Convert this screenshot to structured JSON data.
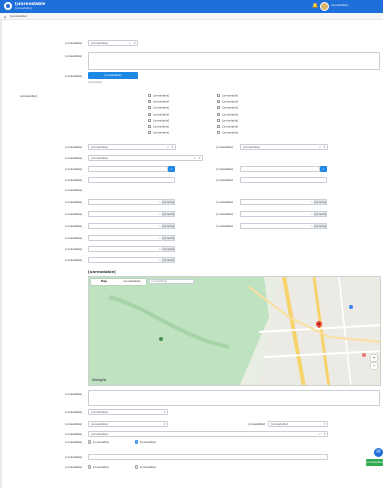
{
  "header": {
    "app_name": "[unreadable]",
    "app_subtitle": "[unreadable]",
    "bell_icon": "bell-icon",
    "user_name": "[unreadable]"
  },
  "breadcrumb": {
    "text": "[unreadable]"
  },
  "form": {
    "prefix_label": "[unreadable]",
    "prefix_value": "[unreadable]",
    "name_label": "[unreadable]",
    "doc_label": "[unreadable]",
    "upload_button": "[unreadable]",
    "upload_hint": "[unreadable]",
    "facilities_label": "[unreadable]",
    "facilities_col1": [
      "[unreadable]",
      "[unreadable]",
      "[unreadable]",
      "[unreadable]",
      "[unreadable]",
      "[unreadable]",
      "[unreadable]"
    ],
    "facilities_col2": [
      "[unreadable]",
      "[unreadable]",
      "[unreadable]",
      "[unreadable]",
      "[unreadable]",
      "[unreadable]",
      "[unreadable]"
    ],
    "type_label": "[unreadable]",
    "type_value": "[unreadable]",
    "type2_label": "[unreadable]",
    "type2_value": "[unreadable]",
    "size_label": "[unreadable]",
    "size_value": "[unreadable]",
    "lat_label": "[unreadable]",
    "lng_label": "[unreadable]",
    "address_label": "[unreadable]",
    "address2_label": "[unreadable]",
    "section_label": "[unreadable]",
    "r1_label_a": "[unreadable]",
    "r1_unit_a": "[unreadable]",
    "r1_label_b": "[unreadable]",
    "r1_unit_b": "[unreadable]",
    "r2_label_a": "[unreadable]",
    "r2_unit_a": "[unreadable]",
    "r2_label_b": "[unreadable]",
    "r2_unit_b": "[unreadable]",
    "r3_label_a": "[unreadable]",
    "r3_unit_a": "[unreadable]",
    "r3_label_b": "[unreadable]",
    "r3_unit_b": "[unreadable]",
    "r4_label": "[unreadable]",
    "r4_unit": "[unreadable]",
    "r5_label": "[unreadable]",
    "r5_unit": "[unreadable]",
    "r6_label": "[unreadable]",
    "r6_unit": "[unreadable]"
  },
  "map": {
    "title": "[unreadable]",
    "tab_map": "Map",
    "tab_satellite": "[unreadable]",
    "search_placeholder": "[unreadable]",
    "zoom_in": "+",
    "zoom_out": "−",
    "google_label": "Google"
  },
  "form2": {
    "desc_label": "[unreadable]",
    "province_label": "[unreadable]",
    "province_value": "[unreadable]",
    "district_label": "[unreadable]",
    "district_value": "[unreadable]",
    "subdistrict_label": "[unreadable]",
    "subdistrict_value": "[unreadable]",
    "zipcode_label": "[unreadable]",
    "zipcode_value": "[unreadable]",
    "radio1_label": "[unreadable]",
    "radio1_opt_a": "[unreadable]",
    "radio1_opt_b": "[unreadable]",
    "contact_label": "[unreadable]",
    "radio2_label": "[unreadable]",
    "radio2_opt_a": "[unreadable]",
    "radio2_opt_b": "[unreadable]"
  },
  "actions": {
    "fab_icon": "chat-icon",
    "save_button": "[unreadable]"
  },
  "colors": {
    "header": "#1e6fd9",
    "primary": "#1e88e5",
    "save": "#2eaa4f",
    "map_green": "#bfe3c0",
    "map_road": "#f7d36b"
  }
}
